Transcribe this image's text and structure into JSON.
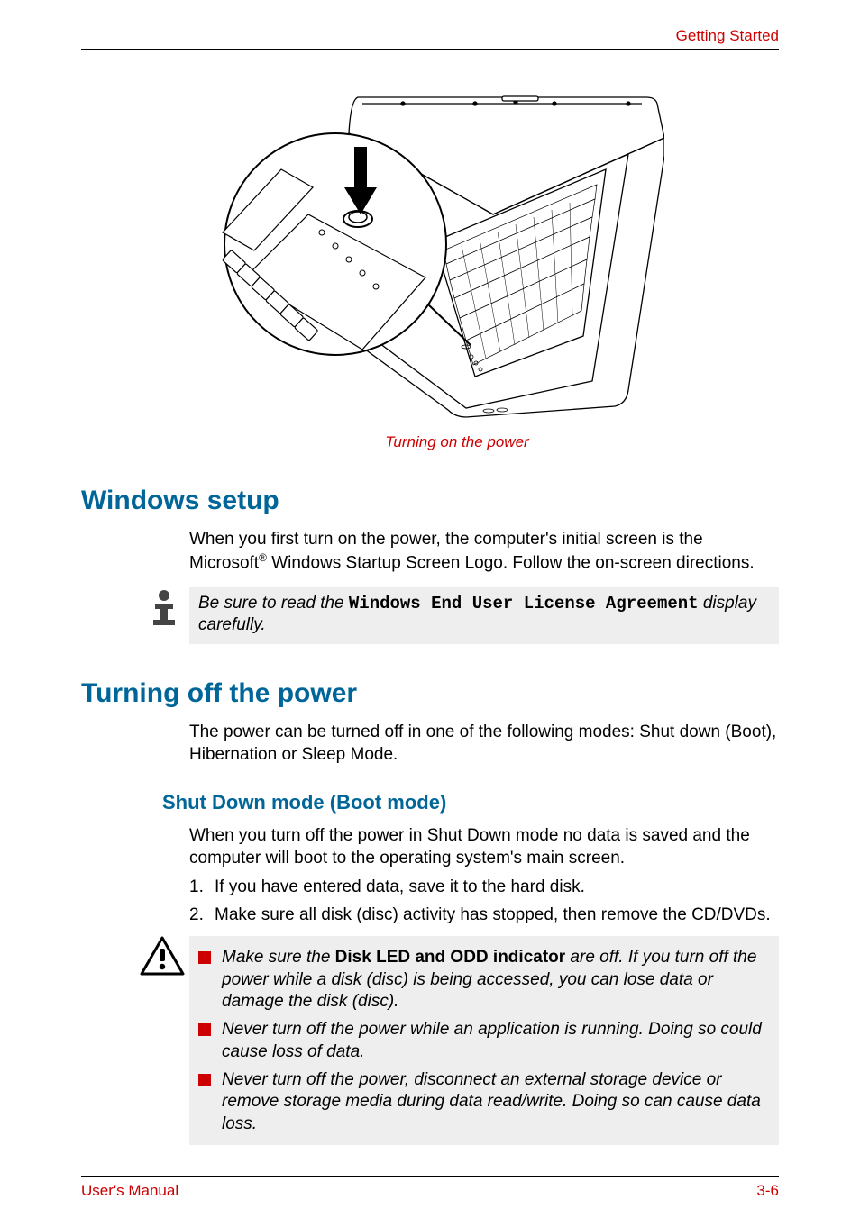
{
  "header": {
    "section": "Getting Started"
  },
  "figure": {
    "caption": "Turning on the power"
  },
  "sections": {
    "windows_setup": {
      "title": "Windows setup",
      "para_a": "When you first turn on the power, the computer's initial screen is the Microsoft",
      "reg": "®",
      "para_b": " Windows Startup Screen Logo. Follow the on-screen directions."
    },
    "note": {
      "lead": "Be sure to read the ",
      "emph": "Windows End User License Agreement",
      "tail": " display carefully."
    },
    "turning_off": {
      "title": "Turning off the power",
      "para": "The power can be turned off in one of the following modes: Shut down (Boot), Hibernation or Sleep Mode."
    },
    "shutdown_mode": {
      "title": "Shut Down mode (Boot mode)",
      "para": "When you turn off the power in Shut Down mode no data is saved and the computer will boot to the operating system's main screen.",
      "steps": [
        "If you have entered data, save it to the hard disk.",
        "Make sure all disk (disc) activity has stopped, then remove the CD/DVDs."
      ]
    },
    "warnings": [
      {
        "pre": "Make sure the ",
        "bold": "Disk LED and ODD indicator",
        "post": " are off. If you turn off the power while a disk (disc) is being accessed, you can lose data or damage the disk (disc)."
      },
      {
        "pre": "",
        "bold": "",
        "post": "Never turn off the power while an application is running. Doing so could cause loss of data."
      },
      {
        "pre": "",
        "bold": "",
        "post": "Never turn off the power, disconnect an external storage device or remove storage media during data read/write. Doing so can cause data loss."
      }
    ]
  },
  "footer": {
    "left": "User's Manual",
    "right": "3-6"
  }
}
